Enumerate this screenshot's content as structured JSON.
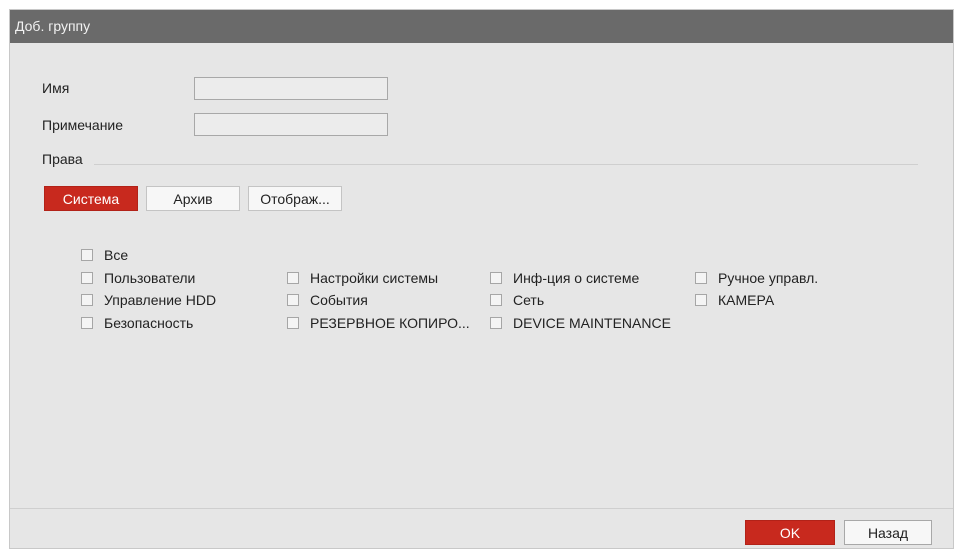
{
  "window": {
    "title": "Доб. группу"
  },
  "form": {
    "name_label": "Имя",
    "name_value": "",
    "note_label": "Примечание",
    "note_value": ""
  },
  "rights": {
    "section_label": "Права",
    "tabs": [
      {
        "label": "Система",
        "active": true
      },
      {
        "label": "Архив",
        "active": false
      },
      {
        "label": "Отображ...",
        "active": false
      }
    ],
    "permissions": {
      "all": "Все",
      "users": "Пользователи",
      "hdd": "Управление HDD",
      "security": "Безопасность",
      "system_settings": "Настройки системы",
      "events": "События",
      "backup": "РЕЗЕРВНОЕ КОПИРО...",
      "system_info": "Инф-ция о системе",
      "network": "Сеть",
      "device_maintenance": "DEVICE MAINTENANCE",
      "manual_control": "Ручное управл.",
      "camera": "КАМЕРА"
    }
  },
  "footer": {
    "ok_label": "OK",
    "back_label": "Назад"
  },
  "colors": {
    "accent": "#c8291e",
    "titlebar": "#6a6a6a",
    "panel": "#e6e6e6"
  }
}
